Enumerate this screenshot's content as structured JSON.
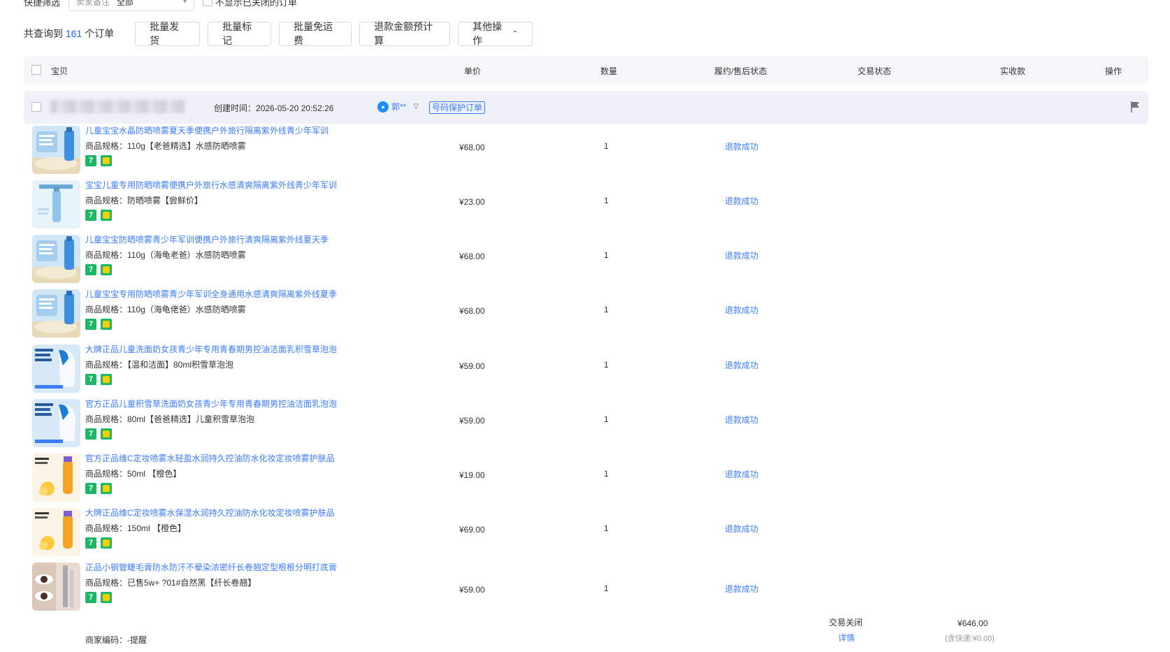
{
  "filter": {
    "label": "快捷筛选",
    "select_label": "卖家备注",
    "select_value": "全部",
    "hide_closed_label": "不显示已关闭的订单"
  },
  "toolbar": {
    "count_prefix": "共查询到",
    "count": "161",
    "count_suffix": "个订单",
    "btn_batch_ship": "批量发货",
    "btn_batch_mark": "批量标记",
    "btn_batch_free_ship": "批量免运费",
    "btn_refund_calc": "退款金额预计算",
    "btn_other": "其他操作"
  },
  "table_header": {
    "item": "宝贝",
    "unit_price": "单价",
    "quantity": "数量",
    "fulfil_status": "履约/售后状态",
    "trade_status": "交易状态",
    "actual_paid": "实收款",
    "actions": "操作"
  },
  "order": {
    "created_label": "创建时间：",
    "created_time": "2026-05-20 20:52:26",
    "buyer": "郭**",
    "protect_badge": "号码保护订单",
    "trade_status": "交易关闭",
    "trade_detail": "详情",
    "actual_paid": "¥646.00",
    "shipping_note": "(含快递:¥0.00)"
  },
  "items": [
    {
      "title": "儿童宝宝水晶防晒喷雾夏天季便携户外旅行隔离紫外线青少年军训",
      "spec": "商品规格：110g【老爸精选】水感防晒喷雾",
      "price": "¥68.00",
      "qty": "1",
      "status": "退款成功",
      "thumb": "spray-blue"
    },
    {
      "title": "宝宝儿童专用防晒喷雾便携户外旅行水感清爽隔离紫外线青少年军训",
      "spec": "商品规格：防晒喷雾【尝鲜价】",
      "price": "¥23.00",
      "qty": "1",
      "status": "退款成功",
      "thumb": "spray-light"
    },
    {
      "title": "儿童宝宝防晒喷雾青少年军训便携户外旅行清爽隔离紫外线夏天季",
      "spec": "商品规格：110g（海龟老爸）水感防晒喷雾",
      "price": "¥68.00",
      "qty": "1",
      "status": "退款成功",
      "thumb": "spray-blue"
    },
    {
      "title": "儿童宝宝专用防晒喷雾青少年军训全身通用水感清爽隔离紫外线夏季",
      "spec": "商品规格：110g（海龟佬爸）水感防晒喷雾",
      "price": "¥68.00",
      "qty": "1",
      "status": "退款成功",
      "thumb": "spray-blue"
    },
    {
      "title": "大牌正品儿童洗面奶女孩青少年专用青春期男控油洁面乳积雪草泡泡",
      "spec": "商品规格：【温和洁面】80ml积雪草泡泡",
      "price": "¥59.00",
      "qty": "1",
      "status": "退款成功",
      "thumb": "cleanser"
    },
    {
      "title": "官方正品儿童积雪草洗面奶女孩青少年专用青春期男控油洁面乳泡泡",
      "spec": "商品规格：80ml【爸爸精选】儿童积雪草泡泡",
      "price": "¥59.00",
      "qty": "1",
      "status": "退款成功",
      "thumb": "cleanser"
    },
    {
      "title": "官方正品维C定妆喷雾水轻盈水润持久控油防水化妆定妆喷雾护肤品",
      "spec": "商品规格：50ml 【橙色】",
      "price": "¥19.00",
      "qty": "1",
      "status": "退款成功",
      "thumb": "vc-spray"
    },
    {
      "title": "大牌正品维C定妆喷雾水保湿水润持久控油防水化妆定妆喷雾护肤品",
      "spec": "商品规格：150ml 【橙色】",
      "price": "¥69.00",
      "qty": "1",
      "status": "退款成功",
      "thumb": "vc-spray"
    },
    {
      "title": "正品小钢管睫毛膏防水防汗不晕染浓密纤长卷翘定型根根分明打底膏",
      "spec": "商品规格：已售5w+ ?01#自然黑【纤长卷翘】",
      "price": "¥59.00",
      "qty": "1",
      "status": "退款成功",
      "thumb": "mascara"
    }
  ],
  "partial_row_text": "商家编码：-提醒"
}
